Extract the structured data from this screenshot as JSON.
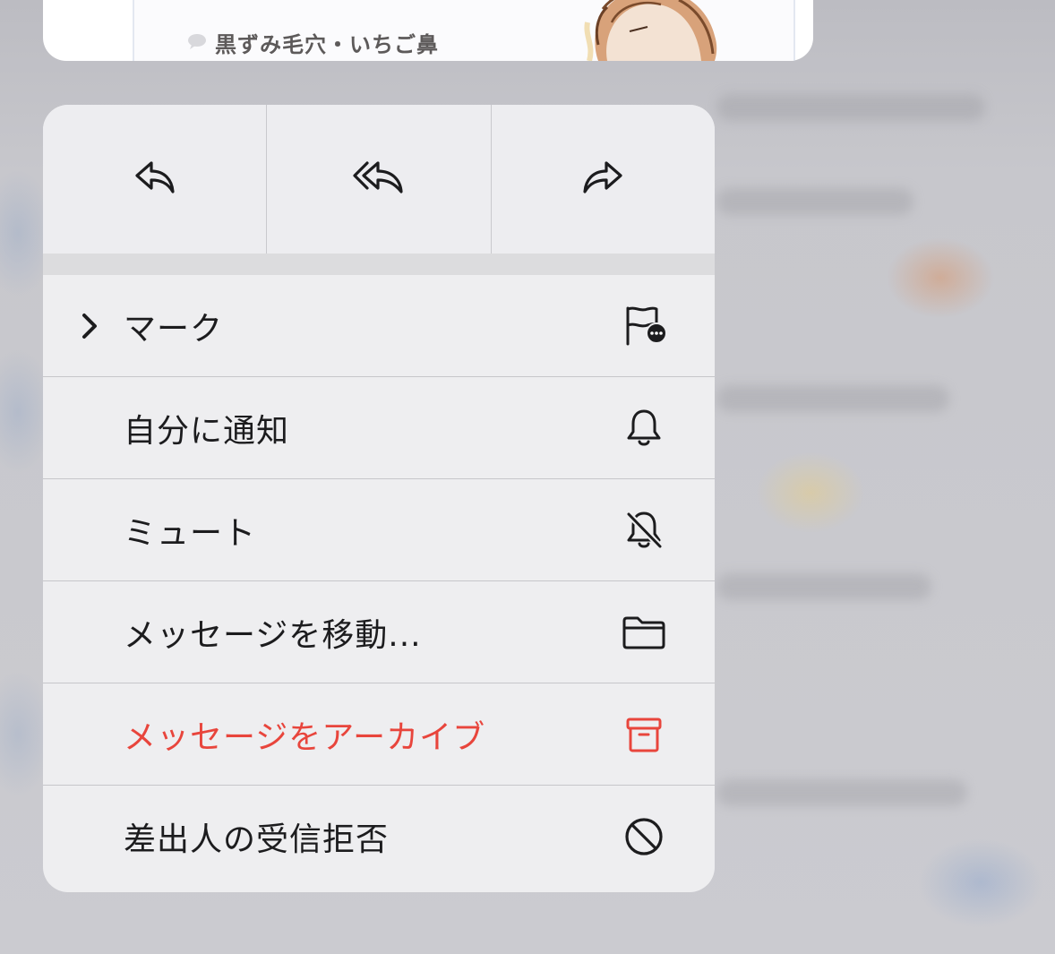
{
  "preview": {
    "snippet": "黒ずみ毛穴・いちご鼻"
  },
  "reply_actions": [
    {
      "icon": "reply-icon"
    },
    {
      "icon": "reply-all-icon"
    },
    {
      "icon": "forward-icon"
    }
  ],
  "menu_items": [
    {
      "label": "マーク",
      "icon": "flag-more-icon",
      "has_submenu": true
    },
    {
      "label": "自分に通知",
      "icon": "bell-icon"
    },
    {
      "label": "ミュート",
      "icon": "bell-slash-icon"
    },
    {
      "label": "メッセージを移動...",
      "icon": "folder-icon"
    },
    {
      "label": "メッセージをアーカイブ",
      "icon": "archive-icon",
      "color": "#E8453C"
    },
    {
      "label": "差出人の受信拒否",
      "icon": "block-icon"
    }
  ],
  "colors": {
    "menu_background": "#EEEEF0",
    "danger": "#E8453C",
    "text": "#1C1C1E"
  }
}
